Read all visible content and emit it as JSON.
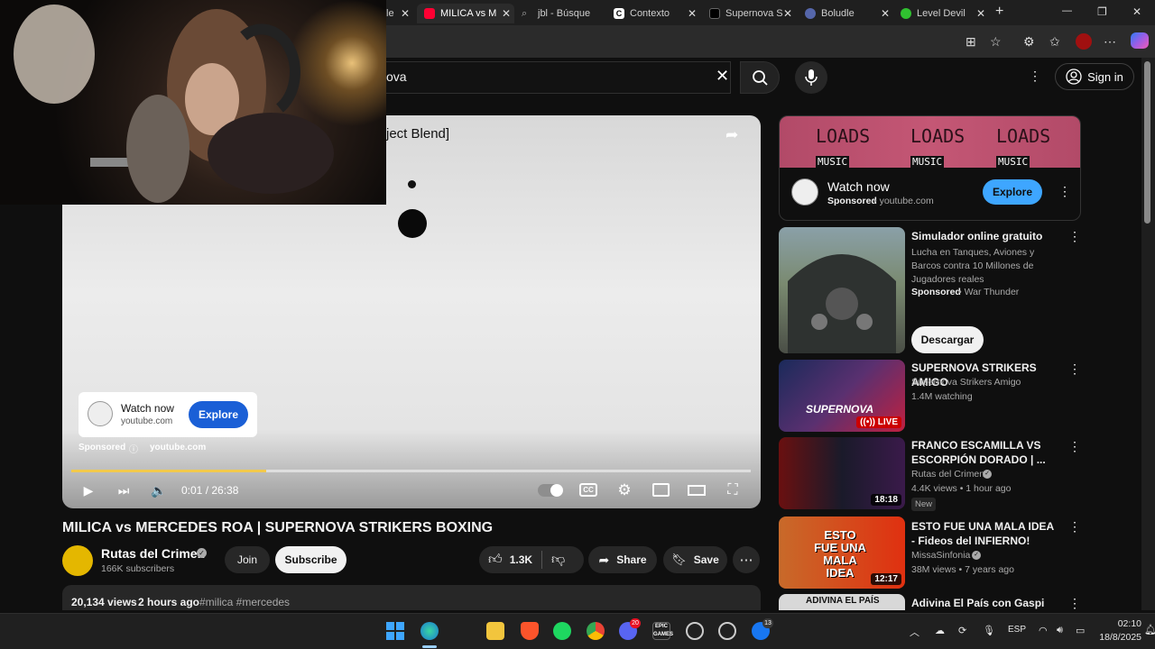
{
  "browser": {
    "tabs": [
      {
        "label": "le",
        "color": "#555"
      },
      {
        "label": "MILICA vs M",
        "color": "#ff0033"
      },
      {
        "label": "jbl - Búsque",
        "color": "#888"
      },
      {
        "label": "Contexto",
        "color": "#fff"
      },
      {
        "label": "Supernova S",
        "color": "#000"
      },
      {
        "label": "Boludle",
        "color": "#5566aa"
      },
      {
        "label": "Level Devil",
        "color": "#30c030"
      }
    ],
    "new_tab": "+",
    "window_controls": {
      "minimize": "—",
      "maximize": "❐",
      "close": "✕"
    }
  },
  "youtube": {
    "search_value": "ova",
    "sign_in": "Sign in",
    "player": {
      "title_fragment": "ject Blend]",
      "time": "0:01 / 26:38",
      "progress_fraction": 0.287,
      "ad": {
        "watch_now": "Watch now",
        "domain": "youtube.com",
        "explore": "Explore",
        "sponsored": "Sponsored",
        "sponsored_domain": "youtube.com"
      }
    },
    "video": {
      "title": "MILICA vs MERCEDES ROA | SUPERNOVA STRIKERS BOXING",
      "channel": "Rutas del Crimen",
      "subscribers": "166K subscribers",
      "join": "Join",
      "subscribe": "Subscribe",
      "likes": "1.3K",
      "share": "Share",
      "save": "Save",
      "views": "20,134 views",
      "age": "2 hours ago",
      "tags": "#milica #mercedes"
    },
    "sidebar": {
      "top_ad": {
        "banner": [
          "LOADS",
          "LOADS",
          "LOADS"
        ],
        "banner_sub": "MUSIC",
        "watch_now": "Watch now",
        "sponsored": "Sponsored",
        "domain": "youtube.com",
        "explore": "Explore"
      },
      "items": [
        {
          "title": "Simulador online gratuito",
          "desc": "Lucha en Tanques, Aviones y Barcos contra 10 Millones de Jugadores reales",
          "line1": "Sponsored",
          "line2": "War Thunder",
          "cta": "Descargar"
        },
        {
          "title": "SUPERNOVA STRIKERS AMIGO",
          "channel": "Supernova Strikers Amigo",
          "meta": "1.4M watching",
          "badge": "LIVE"
        },
        {
          "title": "FRANCO ESCAMILLA VS ESCORPIÓN DORADO | ...",
          "channel": "Rutas del Crimen",
          "meta": "4.4K views • 1 hour ago",
          "badge": "New",
          "duration": "18:18"
        },
        {
          "title": "ESTO FUE UNA MALA IDEA - Fideos del INFIERNO!",
          "channel": "MissaSinfonia",
          "meta": "38M views • 7 years ago",
          "duration": "12:17",
          "thumb_text": "ESTO FUE UNA MALA IDEA"
        },
        {
          "title": "Adivina El País con Gaspi",
          "thumb_text": "ADIVINA EL PAÍS"
        }
      ]
    }
  },
  "taskbar": {
    "language": "ESP",
    "time": "02:10",
    "date": "18/8/2025",
    "badges": {
      "discord": "20",
      "facebook": "13"
    }
  }
}
